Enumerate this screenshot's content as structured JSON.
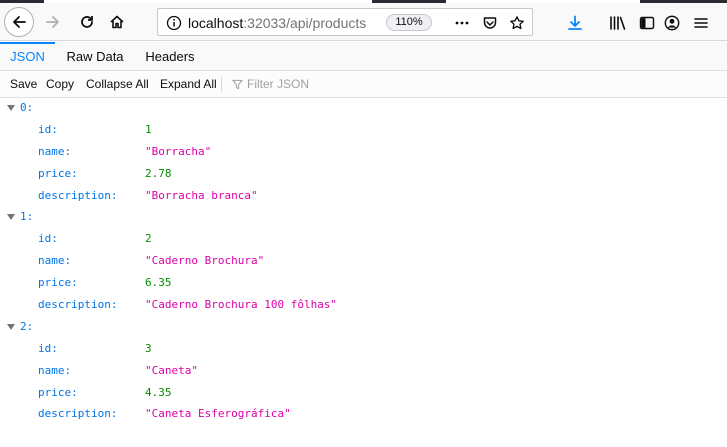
{
  "browser": {
    "url_host": "localhost",
    "url_rest": ":32033/api/products",
    "zoom": "110%"
  },
  "tabs": [
    {
      "label": "JSON",
      "active": true
    },
    {
      "label": "Raw Data",
      "active": false
    },
    {
      "label": "Headers",
      "active": false
    }
  ],
  "toolbar": {
    "save": "Save",
    "copy": "Copy",
    "collapse_all": "Collapse All",
    "expand_all": "Expand All",
    "filter_placeholder": "Filter JSON"
  },
  "labels": {
    "id": "id:",
    "name": "name:",
    "price": "price:",
    "description": "description:"
  },
  "products": [
    {
      "index": "0:",
      "id": "1",
      "name": "\"Borracha\"",
      "price": "2.78",
      "description": "\"Borracha branca\""
    },
    {
      "index": "1:",
      "id": "2",
      "name": "\"Caderno Brochura\"",
      "price": "6.35",
      "description": "\"Caderno Brochura 100 fôlhas\""
    },
    {
      "index": "2:",
      "id": "3",
      "name": "\"Caneta\"",
      "price": "4.35",
      "description": "\"Caneta Esferográfica\""
    }
  ],
  "colors": {
    "accent": "#0a84ff",
    "key": "#0074e8",
    "number": "#058b00",
    "string": "#dd00a9"
  },
  "icons": [
    "back-arrow-icon",
    "forward-arrow-icon",
    "reload-icon",
    "home-icon",
    "info-icon",
    "more-dots-icon",
    "pocket-icon",
    "bookmark-star-icon",
    "download-icon",
    "library-icon",
    "sidebar-icon",
    "account-icon",
    "menu-icon",
    "filter-icon",
    "twisty-icon"
  ]
}
